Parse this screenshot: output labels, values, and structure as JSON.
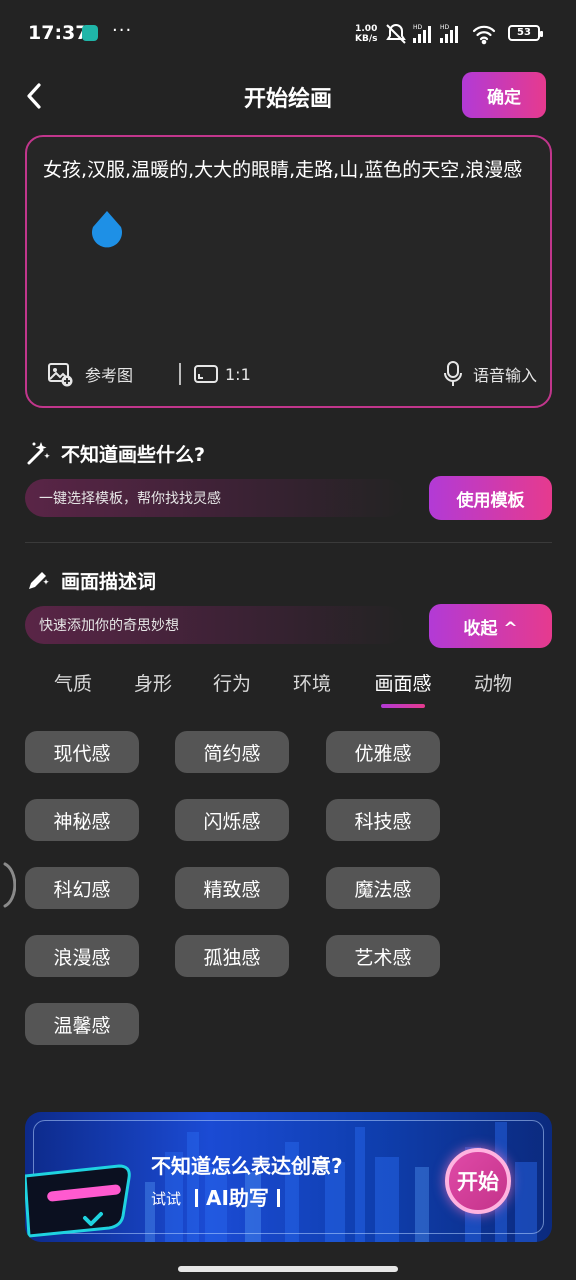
{
  "status_bar": {
    "time": "17:37",
    "more": "···",
    "speed_value": "1.00",
    "speed_unit": "KB/s",
    "battery": "53"
  },
  "header": {
    "title": "开始绘画",
    "confirm_label": "确定"
  },
  "prompt": {
    "text": "女孩,汉服,温暖的,大大的眼睛,走路,山,蓝色的天空,浪漫感",
    "reference_image_label": "参考图",
    "ratio_label": "1:1",
    "voice_input_label": "语音输入"
  },
  "template_section": {
    "title": "不知道画些什么?",
    "hint": "一键选择模板，帮你找找灵感",
    "button_label": "使用模板"
  },
  "descriptor_section": {
    "title": "画面描述词",
    "hint": "快速添加你的奇思妙想",
    "collapse_label": "收起 ^"
  },
  "tabs": [
    {
      "label": "气质"
    },
    {
      "label": "身形"
    },
    {
      "label": "行为"
    },
    {
      "label": "环境"
    },
    {
      "label": "画面感"
    },
    {
      "label": "动物"
    }
  ],
  "active_tab": "画面感",
  "chips": [
    {
      "label": "现代感"
    },
    {
      "label": "简约感"
    },
    {
      "label": "优雅感"
    },
    {
      "label": "神秘感"
    },
    {
      "label": "闪烁感"
    },
    {
      "label": "科技感"
    },
    {
      "label": "科幻感"
    },
    {
      "label": "精致感"
    },
    {
      "label": "魔法感"
    },
    {
      "label": "浪漫感"
    },
    {
      "label": "孤独感"
    },
    {
      "label": "艺术感"
    },
    {
      "label": "温馨感"
    }
  ],
  "banner": {
    "title": "不知道怎么表达创意?",
    "try_label": "试试",
    "ai_label": "AI助写",
    "start_label": "开始"
  },
  "colors": {
    "background": "#232323",
    "accent_start": "#b23ad6",
    "accent_end": "#e63a8e",
    "chip": "#555555",
    "prompt_border": "#c1368c"
  },
  "icons": {
    "back": "chevron-left-icon",
    "reference_image": "image-add-icon",
    "ratio": "aspect-ratio-icon",
    "voice": "microphone-icon",
    "magic": "magic-wand-icon",
    "descriptor": "pen-sparkle-icon"
  }
}
